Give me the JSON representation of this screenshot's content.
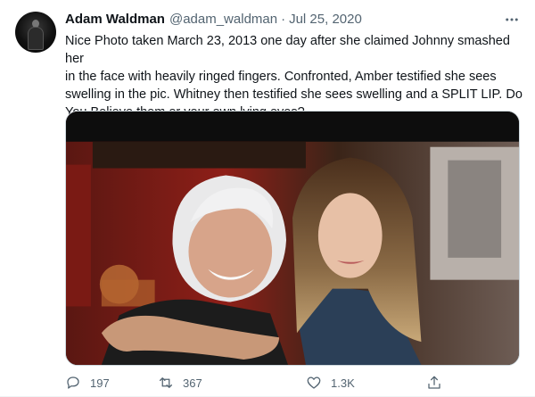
{
  "tweet": {
    "display_name": "Adam Waldman",
    "handle": "@adam_waldman",
    "separator": "·",
    "date": "Jul 25, 2020",
    "lines": [
      "Nice Photo taken March 23, 2013 one day after she claimed Johnny smashed her",
      "in the face with heavily ringed fingers. Confronted, Amber testified she sees",
      "swelling in the pic. Whitney then testified she sees swelling and a SPLIT LIP. Do",
      "You Believe them or your own lying eyes?"
    ]
  },
  "actions": {
    "reply": {
      "icon": "reply-icon",
      "count": "197"
    },
    "retweet": {
      "icon": "retweet-icon",
      "count": "367"
    },
    "like": {
      "icon": "heart-icon",
      "count": "1.3K"
    },
    "share": {
      "icon": "share-icon"
    }
  },
  "colors": {
    "text_primary": "#0f1419",
    "text_secondary": "#536471",
    "border": "#cfd9de"
  }
}
